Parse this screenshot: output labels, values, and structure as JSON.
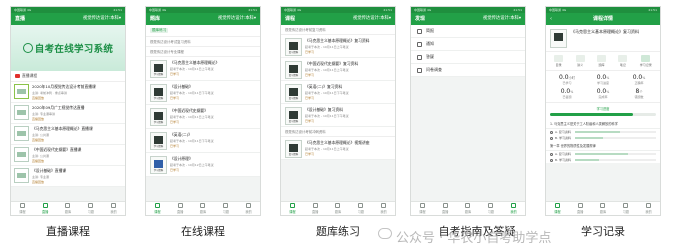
{
  "captions": [
    "直播课程",
    "在线课程",
    "题库练习",
    "自考指南及答疑",
    "学习记录"
  ],
  "watermark": "公众号 · 华农小自考助学点",
  "status": {
    "left": "中国联通 4G",
    "right": "21:51"
  },
  "screens": {
    "live": {
      "title": "直播",
      "subtitle": "视觉传达设计:本科▾",
      "banner": "自考在线学习系统",
      "section": "直播课程",
      "rows": [
        {
          "t1": "2020年10月视觉传达设计考前直播课",
          "t2": "主讲: 考前冲刺 · 重点串讲",
          "t3": "直播回放"
        },
        {
          "t1": "2020年09月广工视觉传达直播",
          "t2": "主讲: 专业课串讲",
          "t3": "直播回放"
        },
        {
          "t1": "《马克思主义基本原理概论》直播课",
          "t2": "主讲: 公共课",
          "t3": "直播回放"
        },
        {
          "t1": "《中国近现代史纲要》直播课",
          "t2": "主讲: 公共课",
          "t3": "直播回放"
        },
        {
          "t1": "《设计基础》直播课",
          "t2": "主讲: 专业课",
          "t3": "直播回放"
        }
      ],
      "tabs": [
        "课程",
        "直播",
        "题库",
        "习题",
        "我的"
      ]
    },
    "course": {
      "title": "题库",
      "subtitle": "视觉传达设计:本科▾",
      "chip": "题库练习",
      "head": "视觉传达设计考试复习资料",
      "sub": "视觉传达设计专业课程",
      "rows": [
        {
          "t1": "《马克思主义基本原理概论》",
          "t2": "起考于本次 - 10月11日上午笔试",
          "t3": "已学习"
        },
        {
          "t1": "《设计基础》",
          "t2": "起考于本次 - 10月11日下午笔试",
          "t3": "已学习"
        },
        {
          "t1": "《中国近现代史纲要》",
          "t2": "起考于本次 - 10月11日上午笔试",
          "t3": "已学习"
        },
        {
          "t1": "《英语(二)》",
          "t2": "起考于本次 - 10月11日下午笔试",
          "t3": "已学习"
        },
        {
          "t1": "《设计原理》",
          "t2": "起考于本次 - 10月12日上午笔试",
          "t3": "已学习"
        }
      ],
      "book_label": "学习资料",
      "tabs": [
        "课程",
        "直播",
        "题库",
        "习题",
        "我的"
      ]
    },
    "bank": {
      "title": "课程",
      "subtitle": "视觉传达设计:本科▾",
      "head": "视觉传达设计考前复习资料",
      "rows": [
        {
          "t1": "《马克思主义基本原理概论》复习资料",
          "t2": "起考于本次 - 10月11日上午笔试",
          "t3": "已学习"
        },
        {
          "t1": "《中国近现代史纲要》复习资料",
          "t2": "起考于本次 - 10月11日上午笔试",
          "t3": "已学习"
        },
        {
          "t1": "《英语(二)》复习资料",
          "t2": "起考于本次 - 10月11日下午笔试",
          "t3": "已学习"
        },
        {
          "t1": "《设计基础》复习资料",
          "t2": "起考于本次 - 10月11日下午笔试",
          "t3": "已学习"
        }
      ],
      "footer": "视觉传达设计考前冲刺资料",
      "last": {
        "t1": "《马克思主义基本原理概论》视频讲座",
        "t2": "起考于本次 - 10月11日上午笔试",
        "t3": "已学习"
      },
      "book_label": "复习资料",
      "tabs": [
        "课程",
        "直播",
        "题库",
        "习题",
        "我的"
      ]
    },
    "guide": {
      "title": "发现",
      "subtitle": "视觉传达设计:本科▾",
      "items": [
        "简报",
        "通知",
        "答疑",
        "问卷调查"
      ],
      "tabs": [
        "课程",
        "直播",
        "题库",
        "习题",
        "我的"
      ]
    },
    "record": {
      "title": "课程详情",
      "course": "《马克思主义基本原理概论》复习资料",
      "icons": [
        "目录",
        "讲义",
        "题库",
        "笔记",
        "学习记录"
      ],
      "stats": [
        {
          "v": "0.0",
          "u": "小时",
          "l": "已学习"
        },
        {
          "v": "0.0",
          "u": "%",
          "l": "学习进度"
        },
        {
          "v": "0.0",
          "u": "%",
          "l": "正确率"
        },
        {
          "v": "0.0",
          "u": "%",
          "l": "已答题"
        },
        {
          "v": "0.0",
          "u": "%",
          "l": "完成率"
        },
        {
          "v": "8",
          "u": "个",
          "l": "错题数"
        }
      ],
      "progress_label": "学习进度",
      "progress_value": 0.78,
      "question": "1. 马克思主义是关于工人阶级和人类解放的科学",
      "options": [
        {
          "label": "A. 复习资料",
          "pct": 0.55
        },
        {
          "label": "B. 学习资料",
          "pct": 0.35
        }
      ],
      "question2": "第一章 世界的物质性及发展规律",
      "options2": [
        {
          "label": "A. 复习资料",
          "pct": 0.65
        },
        {
          "label": "B. 学习资料",
          "pct": 0.3
        }
      ],
      "tabs": [
        "课程",
        "直播",
        "题库",
        "习题",
        "我的"
      ]
    }
  }
}
